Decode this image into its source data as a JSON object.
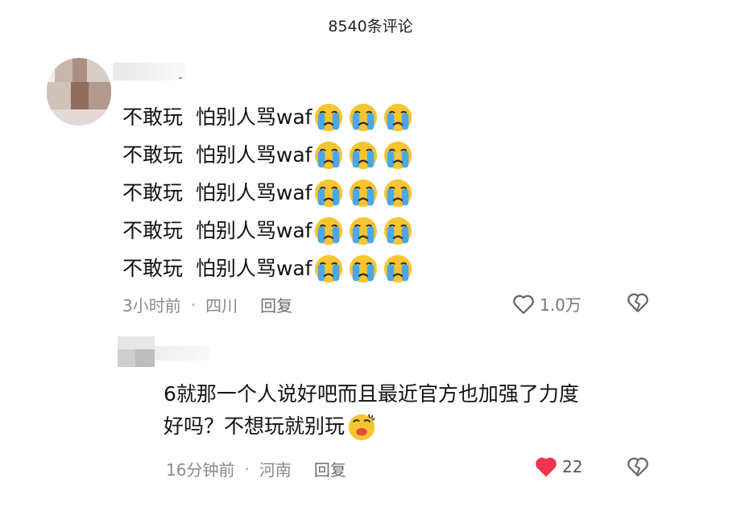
{
  "header": {
    "title": "8540条评论"
  },
  "comments": [
    {
      "lines": [
        {
          "text": "不敢玩  怕别人骂waf",
          "emoji": [
            "crying-face",
            "crying-face",
            "crying-face"
          ]
        },
        {
          "text": "不敢玩  怕别人骂waf",
          "emoji": [
            "crying-face",
            "crying-face",
            "crying-face"
          ]
        },
        {
          "text": "不敢玩  怕别人骂waf",
          "emoji": [
            "crying-face",
            "crying-face",
            "crying-face"
          ]
        },
        {
          "text": "不敢玩  怕别人骂waf",
          "emoji": [
            "crying-face",
            "crying-face",
            "crying-face"
          ]
        },
        {
          "text": "不敢玩  怕别人骂waf",
          "emoji": [
            "crying-face",
            "crying-face",
            "crying-face"
          ]
        }
      ],
      "time": "3小时前",
      "separator": "·",
      "location": "四川",
      "reply_label": "回复",
      "likes": "1.0万",
      "liked": false
    },
    {
      "lines": [
        {
          "text": "6就那一个人说好吧而且最近官方也加强了力度"
        },
        {
          "text": "好吗？不想玩就别玩",
          "emoji": [
            "kissing-face"
          ]
        }
      ],
      "time": "16分钟前",
      "separator": "·",
      "location": "河南",
      "reply_label": "回复",
      "likes": "22",
      "liked": true
    }
  ],
  "colors": {
    "like_active": "#f0354f",
    "emoji_yellow": "#f7c531",
    "tear_blue": "#4aa8e8"
  },
  "icons": [
    "heart-outline-icon",
    "heart-filled-icon",
    "broken-heart-icon",
    "crying-face-emoji",
    "kissing-face-emoji"
  ]
}
